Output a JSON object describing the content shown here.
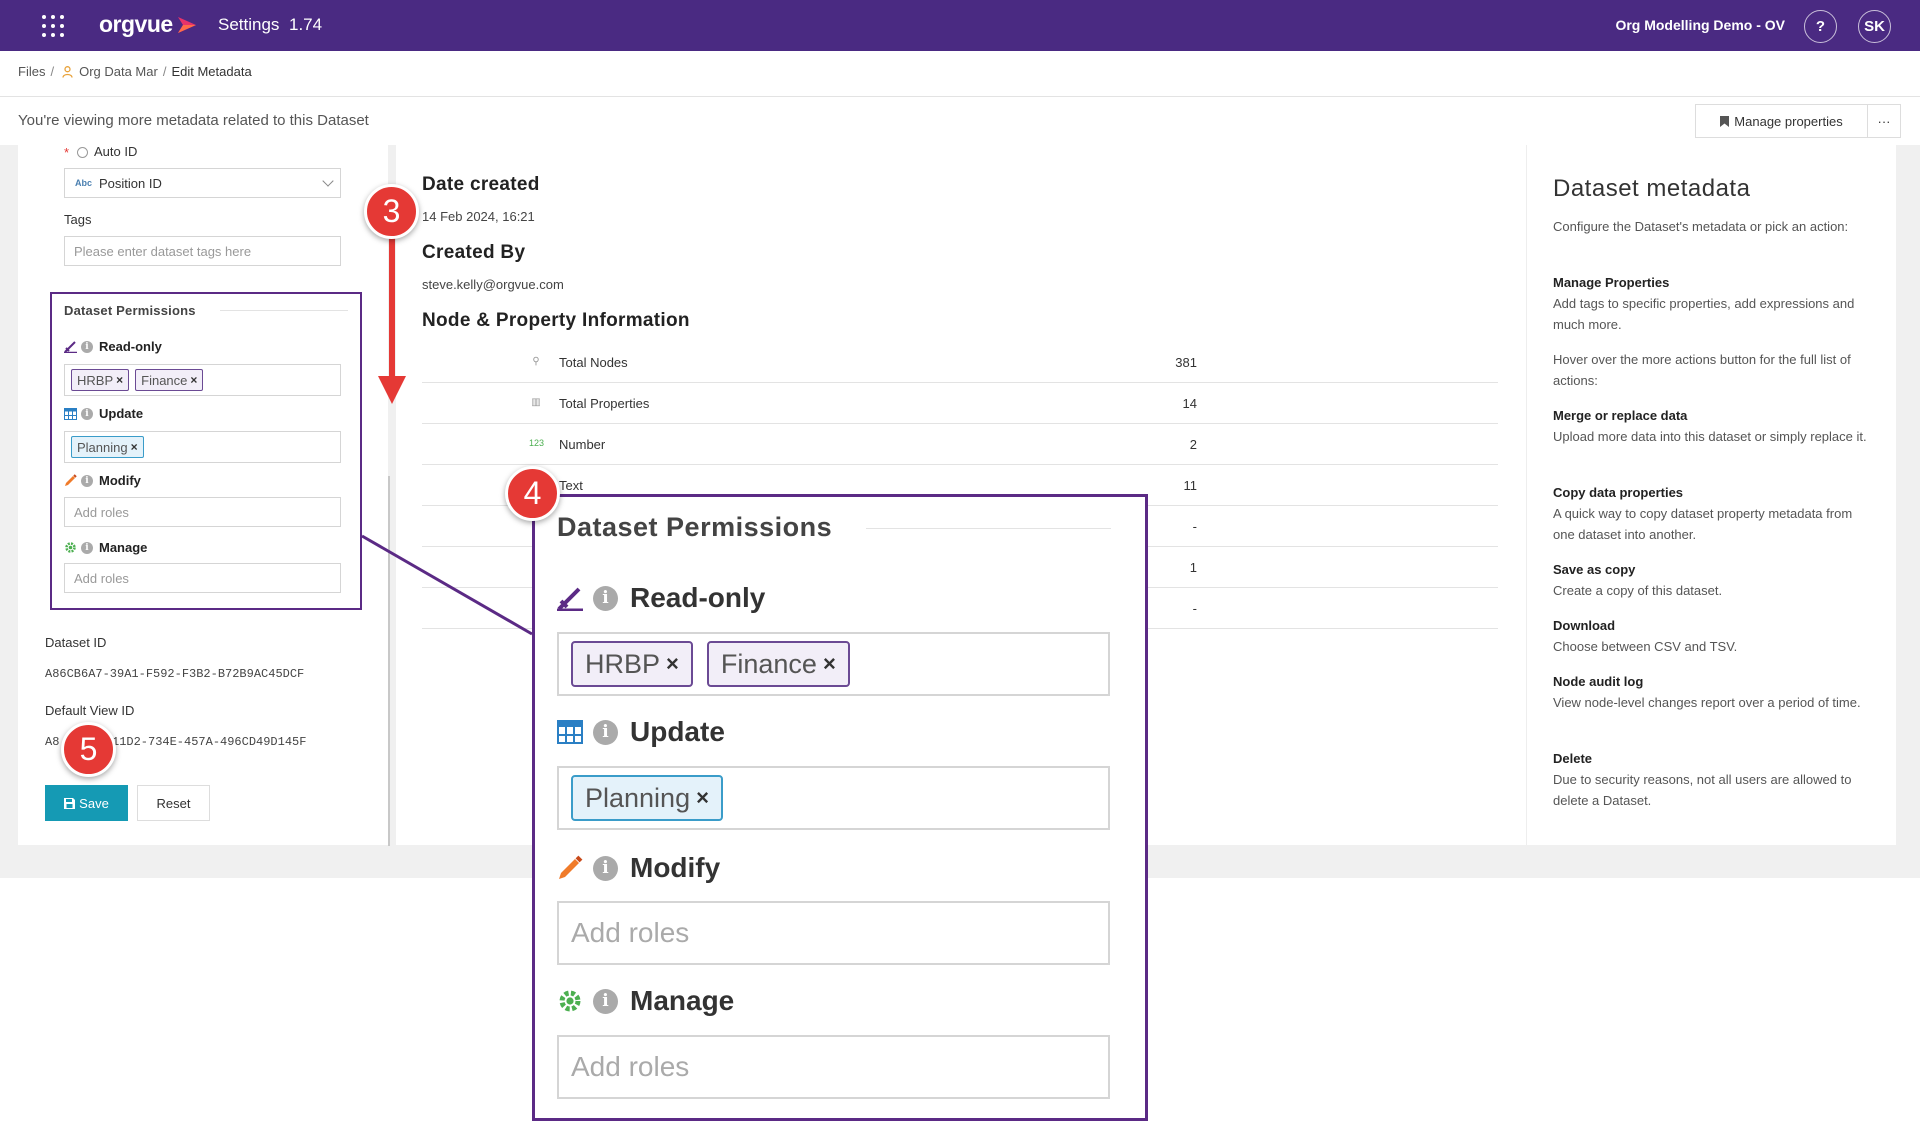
{
  "header": {
    "logo_text": "orgvue",
    "app_title": "Settings",
    "app_version": "1.74",
    "org_name": "Org Modelling Demo - OV",
    "help_label": "?",
    "avatar_initials": "SK"
  },
  "breadcrumb": {
    "files": "Files",
    "sep": "/",
    "dataset": "Org Data Mar",
    "current": "Edit Metadata"
  },
  "infobar": {
    "message": "You're viewing more metadata related to this Dataset",
    "manage_properties": "Manage properties",
    "more": "···"
  },
  "left": {
    "auto_id_label": "Auto ID",
    "required_star": "*",
    "id_property": "Position ID",
    "abc_label": "Abc",
    "tags_label": "Tags",
    "tags_placeholder": "Please enter dataset tags here",
    "permissions": {
      "title": "Dataset Permissions",
      "read_only": {
        "label": "Read-only",
        "tags": [
          "HRBP",
          "Finance"
        ]
      },
      "update": {
        "label": "Update",
        "tags": [
          "Planning"
        ]
      },
      "modify": {
        "label": "Modify",
        "placeholder": "Add roles"
      },
      "manage": {
        "label": "Manage",
        "placeholder": "Add roles"
      },
      "info": "i",
      "remove": "×"
    },
    "dataset_id_label": "Dataset ID",
    "dataset_id": "A86CB6A7-39A1-F592-F3B2-B72B9AC45DCF",
    "default_view_label": "Default View ID",
    "default_view_prefix": "A8",
    "default_view_suffix": "11D2-734E-457A-496CD49D145F",
    "save_label": "Save",
    "reset_label": "Reset"
  },
  "middle": {
    "date_created_label": "Date created",
    "date_created": "14 Feb 2024, 16:21",
    "created_by_label": "Created By",
    "created_by": "steve.kelly@orgvue.com",
    "node_info_label": "Node & Property Information",
    "rows": [
      {
        "icon": "⚲",
        "label": "Total Nodes",
        "value": "381"
      },
      {
        "icon": "▥",
        "label": "Total Properties",
        "value": "14"
      },
      {
        "icon": "123",
        "label": "Number",
        "value": "2"
      },
      {
        "icon": "",
        "label": "Text",
        "value": "11"
      },
      {
        "icon": "",
        "label": "",
        "value": "-"
      },
      {
        "icon": "",
        "label": "",
        "value": "1"
      },
      {
        "icon": "",
        "label": "",
        "value": "-"
      }
    ]
  },
  "right": {
    "title": "Dataset metadata",
    "intro": "Configure the Dataset's metadata or pick an action:",
    "manage_head": "Manage Properties",
    "manage_text": "Add tags to specific properties, add expressions and much more.",
    "hover_text": "Hover over the more actions button for the full list of actions:",
    "merge_head": "Merge or replace data",
    "merge_text": "Upload more data into this dataset or simply replace it.",
    "copy_head": "Copy data properties",
    "copy_text": "A quick way to copy dataset property metadata from one dataset into another.",
    "save_copy_head": "Save as copy",
    "save_copy_text": "Create a copy of this dataset.",
    "download_head": "Download",
    "download_text": "Choose between CSV and TSV.",
    "audit_head": "Node audit log",
    "audit_text": "View node-level changes report over a period of time.",
    "delete_head": "Delete",
    "delete_text": "Due to security reasons, not all users are allowed to delete a Dataset."
  },
  "annotations": {
    "step3": "3",
    "step4": "4",
    "step5": "5"
  },
  "colors": {
    "header_bg": "#4a2a82",
    "accent_teal": "#159ab4",
    "annotation_red": "#e53935",
    "highlight_purple": "#5b2a85"
  }
}
